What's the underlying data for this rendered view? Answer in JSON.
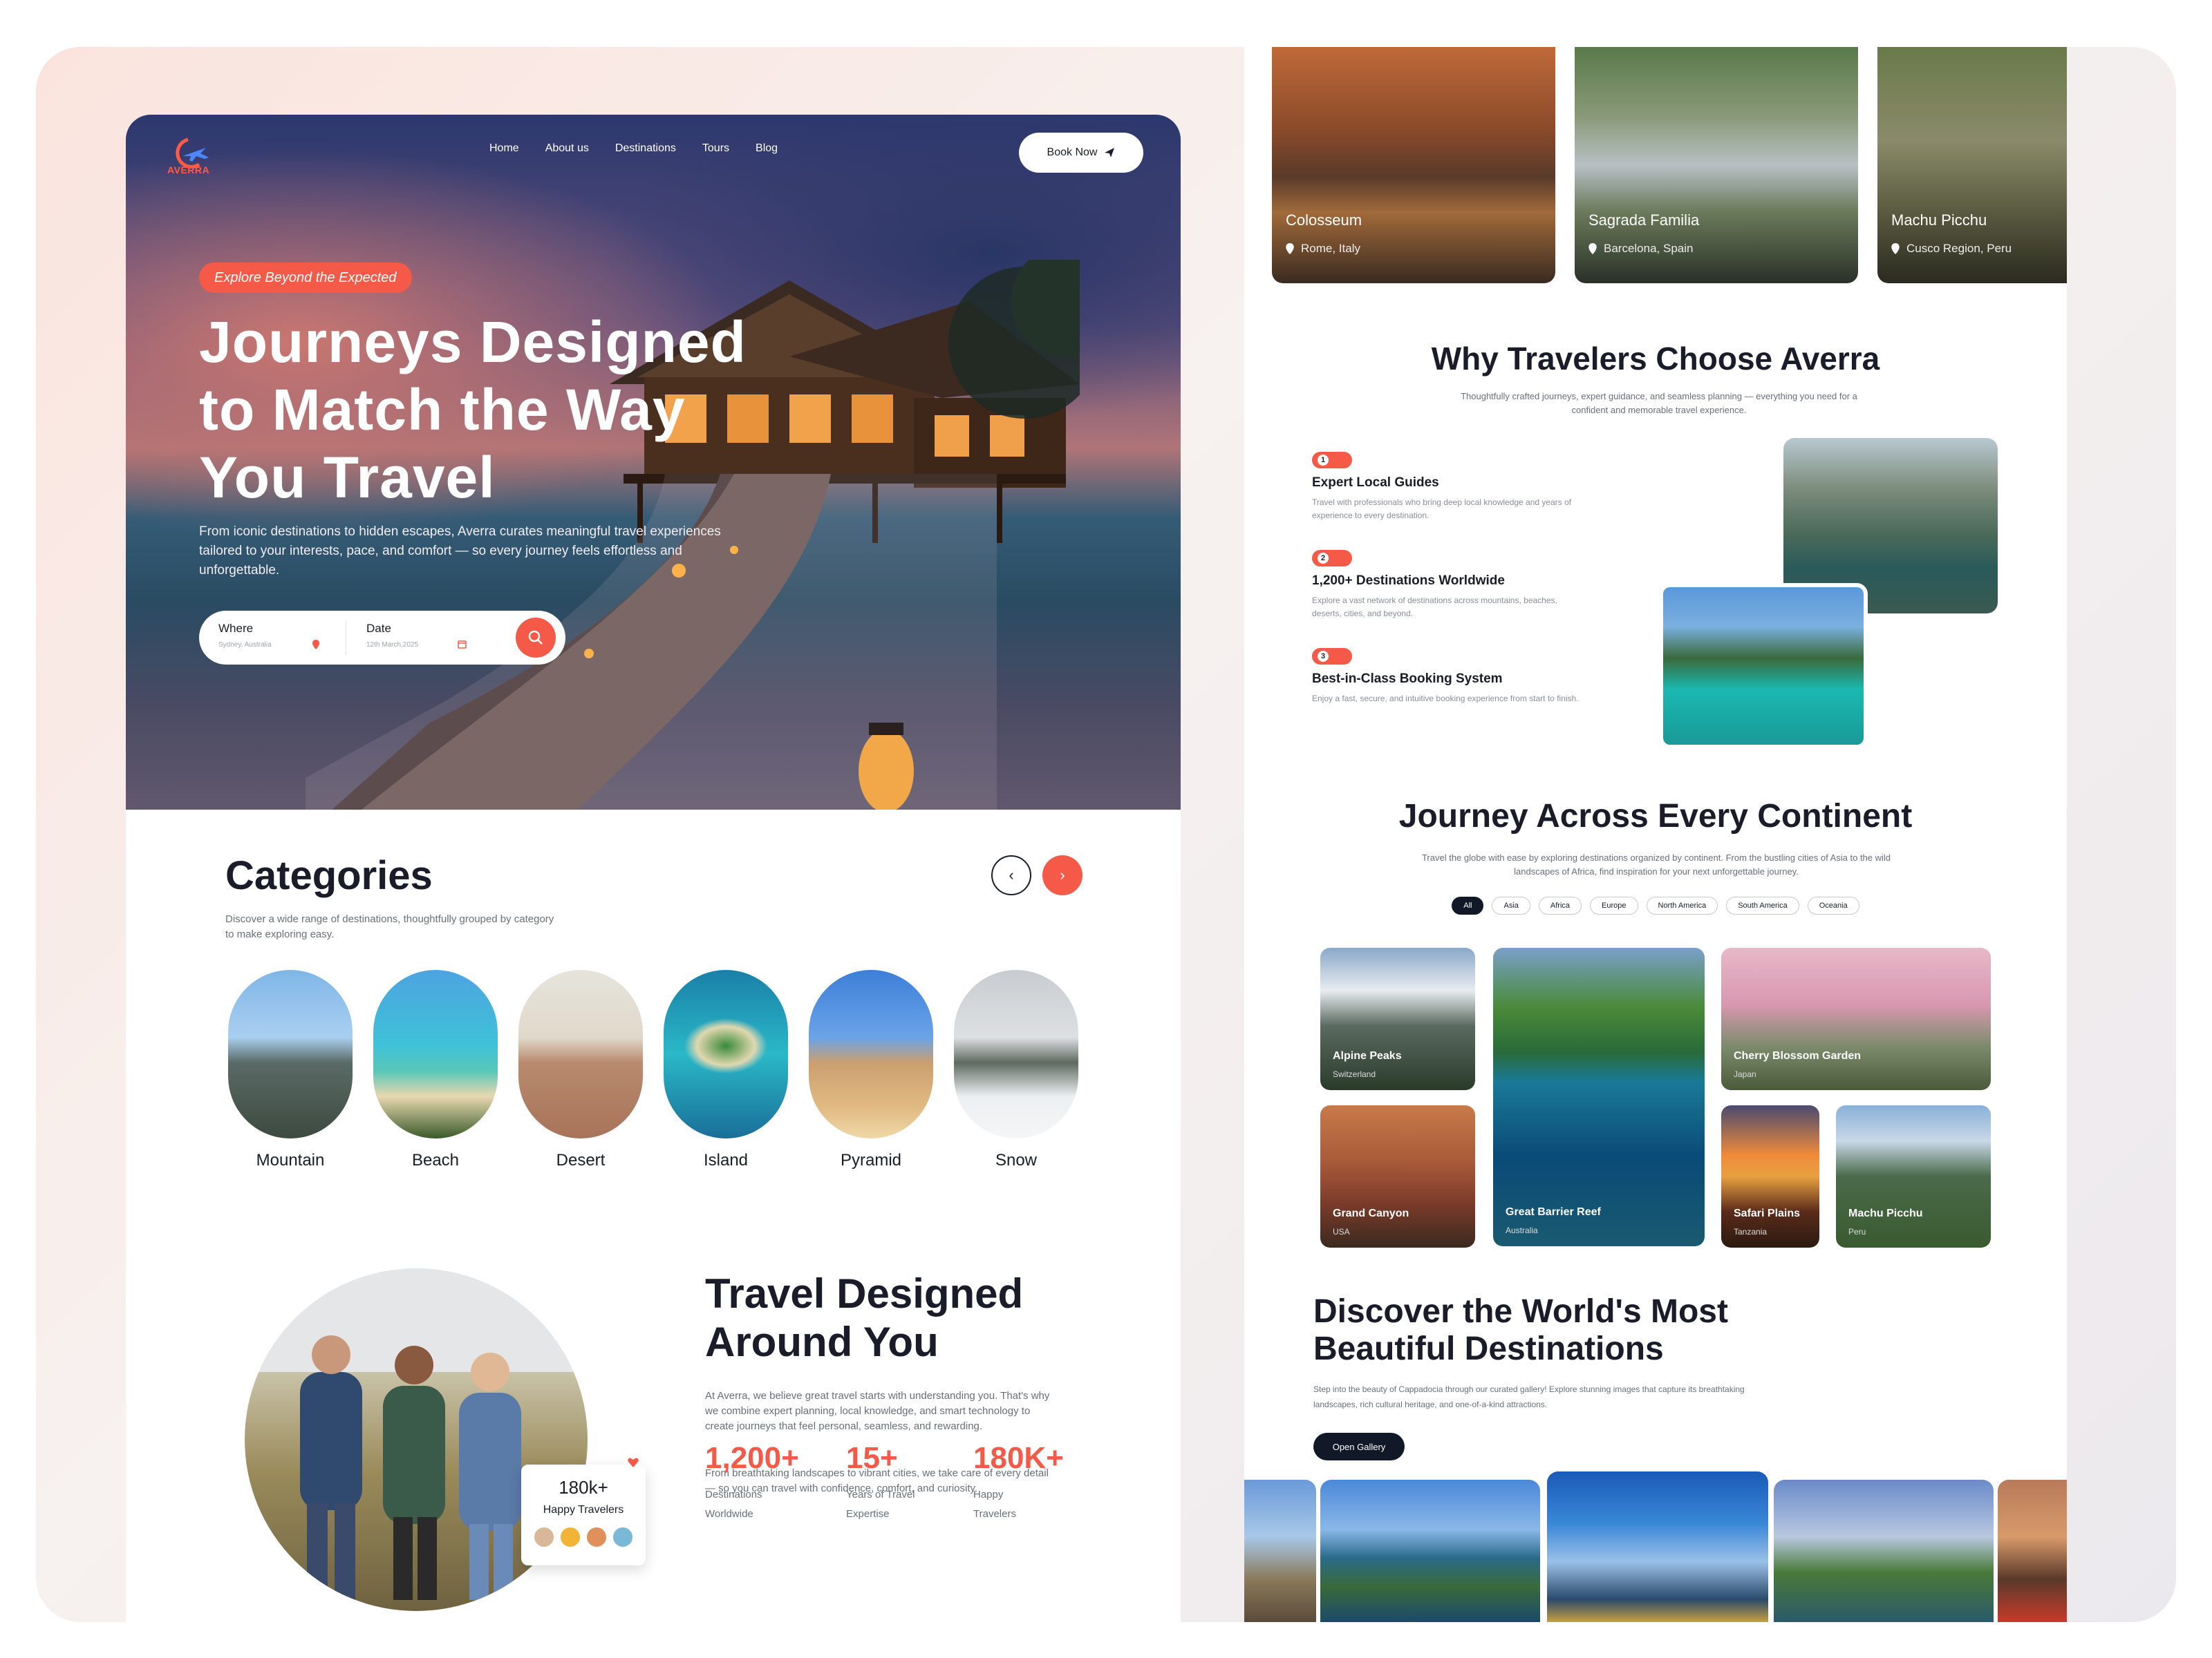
{
  "brand": {
    "name": "AVERRA",
    "accent": "#f45a47",
    "dark": "#111827"
  },
  "nav": {
    "items": [
      "Home",
      "About us",
      "Destinations",
      "Tours",
      "Blog"
    ],
    "book_label": "Book Now"
  },
  "hero": {
    "tag": "Explore Beyond the Expected",
    "title_lines": [
      "Journeys Designed",
      "to Match the Way",
      "You Travel"
    ],
    "lead": "From iconic destinations to hidden escapes, Averra curates meaningful travel experiences tailored to your interests, pace, and comfort — so every journey feels effortless and unforgettable.",
    "search": {
      "where_label": "Where",
      "where_placeholder": "Sydney, Australia",
      "date_label": "Date",
      "date_placeholder": "12th March,2025"
    }
  },
  "categories": {
    "title": "Categories",
    "desc": "Discover a wide range of destinations, thoughtfully grouped by category to make exploring easy.",
    "items": [
      "Mountain",
      "Beach",
      "Desert",
      "Island",
      "Pyramid",
      "Snow"
    ]
  },
  "travel_designed": {
    "title_lines": [
      "Travel Designed",
      "Around You"
    ],
    "p1": "At Averra, we believe great travel starts with understanding you. That's why we combine expert planning, local knowledge, and smart technology to create journeys that feel personal, seamless, and rewarding.",
    "p2": "From breathtaking landscapes to vibrant cities, we take care of every detail — so you can travel with confidence, comfort, and curiosity.",
    "happy_count": "180k+",
    "happy_label": "Happy Travelers",
    "stats": [
      {
        "value": "1,200+",
        "label": "Destinations Worldwide"
      },
      {
        "value": "15+",
        "label": "Years of Travel Expertise"
      },
      {
        "value": "180K+",
        "label": "Happy Travelers"
      }
    ]
  },
  "top_cards": [
    {
      "title": "Colosseum",
      "location": "Rome, Italy"
    },
    {
      "title": "Sagrada Familia",
      "location": "Barcelona, Spain"
    },
    {
      "title": "Machu Picchu",
      "location": "Cusco Region, Peru"
    }
  ],
  "why": {
    "title": "Why Travelers Choose Averra",
    "desc": "Thoughtfully crafted journeys, expert guidance, and seamless planning — everything you need for a confident and memorable travel experience.",
    "features": [
      {
        "num": "1",
        "title": "Expert Local Guides",
        "desc": "Travel with professionals who bring deep local knowledge and years of experience to every destination."
      },
      {
        "num": "2",
        "title": "1,200+ Destinations Worldwide",
        "desc": "Explore a vast network of destinations across mountains, beaches, deserts, cities, and beyond."
      },
      {
        "num": "3",
        "title": "Best-in-Class Booking System",
        "desc": "Enjoy a fast, secure, and intuitive booking experience from start to finish."
      }
    ]
  },
  "continent": {
    "title": "Journey Across Every Continent",
    "desc": "Travel the globe with ease by exploring destinations organized by continent. From the bustling cities of Asia to the wild landscapes of Africa, find inspiration for your next unforgettable journey.",
    "filters": [
      "All",
      "Asia",
      "Africa",
      "Europe",
      "North America",
      "South America",
      "Oceania"
    ],
    "cards": [
      {
        "name": "Alpine Peaks",
        "country": "Switzerland"
      },
      {
        "name": "Great Barrier Reef",
        "country": "Australia"
      },
      {
        "name": "Cherry Blossom Garden",
        "country": "Japan"
      },
      {
        "name": "Grand Canyon",
        "country": "USA"
      },
      {
        "name": "Safari Plains",
        "country": "Tanzania"
      },
      {
        "name": "Machu Picchu",
        "country": "Peru"
      }
    ]
  },
  "discover": {
    "title_lines": [
      "Discover the World's Most",
      "Beautiful Destinations"
    ],
    "desc": "Step into the beauty of Cappadocia through our curated gallery! Explore stunning images that capture its breathtaking landscapes, rich cultural heritage, and one-of-a-kind attractions.",
    "button": "Open Gallery"
  }
}
